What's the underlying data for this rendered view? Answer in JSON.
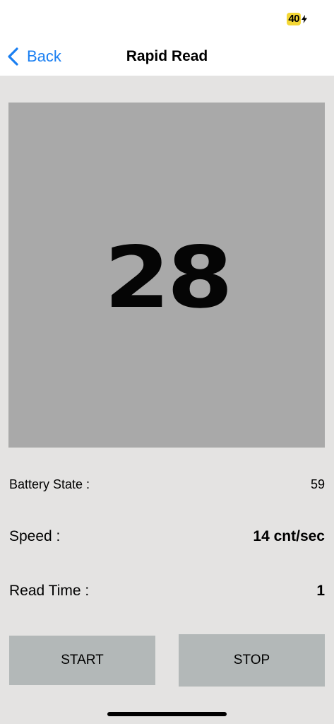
{
  "status_bar": {
    "battery_level": "40",
    "battery_icon": "bolt-icon"
  },
  "nav": {
    "back_label": "Back",
    "back_icon": "chevron-left-icon",
    "title": "Rapid Read"
  },
  "counter": {
    "value": "28"
  },
  "info": {
    "battery_state_label": "Battery State :",
    "battery_state_value": "59",
    "speed_label": "Speed :",
    "speed_value": "14 cnt/sec",
    "read_time_label": "Read Time :",
    "read_time_value": "1"
  },
  "buttons": {
    "start_label": "START",
    "stop_label": "STOP"
  },
  "colors": {
    "accent": "#1a7ff2",
    "background": "#e4e3e2",
    "panel": "#a9a9a9",
    "button": "#b3b8b8",
    "battery_highlight": "#f4d735"
  }
}
